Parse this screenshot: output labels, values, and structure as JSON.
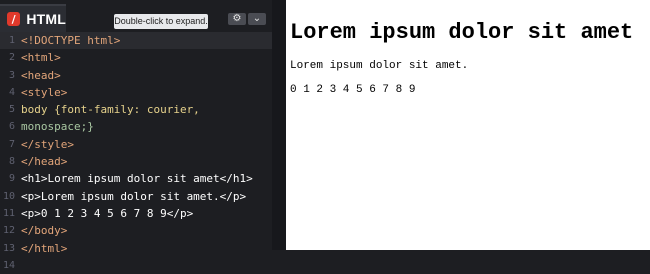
{
  "editor": {
    "tab_label": "HTML",
    "badge_glyph": "/",
    "tooltip": "Double-click to expand.",
    "settings_icon": "gear-icon",
    "collapse_icon": "chevron-down-icon",
    "line_numbers": [
      "1",
      "2",
      "3",
      "4",
      "5",
      "6",
      "7",
      "8",
      "9",
      "10",
      "11",
      "12",
      "13",
      "14"
    ],
    "code_lines": [
      "<!DOCTYPE html>",
      "<html>",
      "<head>",
      "<style>",
      "body {font-family: courier,",
      "monospace;}",
      "</style>",
      "</head>",
      "<h1>Lorem ipsum dolor sit amet</h1>",
      "<p>Lorem ipsum dolor sit amet.</p>",
      "<p>0 1 2 3 4 5 6 7 8 9</p>",
      "</body>",
      "</html>",
      ""
    ],
    "colors": {
      "tag": "#e2a57a",
      "text": "#ffffff",
      "property": "#a9c7a2",
      "value": "#e6d28c",
      "badge": "#e0392b"
    }
  },
  "preview": {
    "heading": "Lorem ipsum dolor sit amet",
    "paragraph": "Lorem ipsum dolor sit amet.",
    "digits": "0 1 2 3 4 5 6 7 8 9"
  }
}
